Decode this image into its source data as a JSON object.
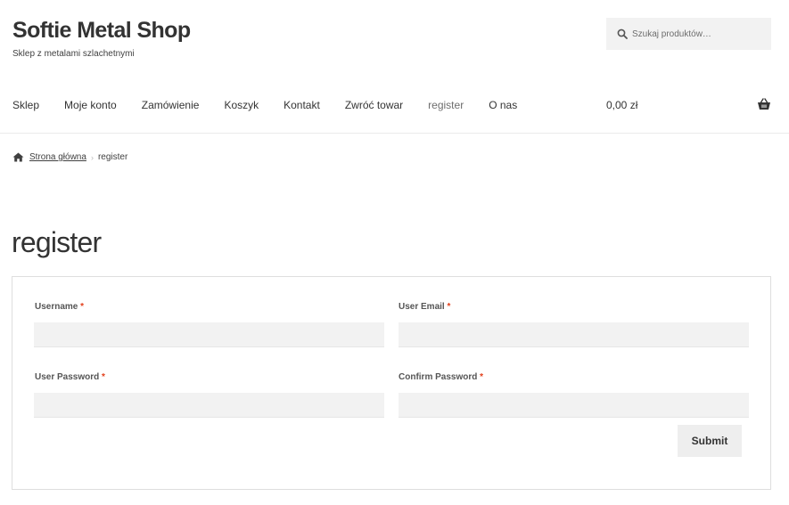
{
  "site": {
    "title": "Softie Metal Shop",
    "tagline": "Sklep z metalami szlachetnymi"
  },
  "search": {
    "placeholder": "Szukaj produktów…",
    "icon": "search-icon"
  },
  "nav": {
    "items": [
      {
        "label": "Sklep"
      },
      {
        "label": "Moje konto"
      },
      {
        "label": "Zamówienie"
      },
      {
        "label": "Koszyk"
      },
      {
        "label": "Kontakt"
      },
      {
        "label": "Zwróć towar"
      },
      {
        "label": "register",
        "current": true
      },
      {
        "label": "O nas"
      }
    ]
  },
  "cart": {
    "total": "0,00 zł",
    "icon": "basket-icon"
  },
  "breadcrumb": {
    "home_icon": "home-icon",
    "home_label": "Strona główna",
    "separator": "›",
    "current": "register"
  },
  "page": {
    "title": "register"
  },
  "form": {
    "required_marker": "*",
    "username_label": "Username",
    "email_label": "User Email",
    "password_label": "User Password",
    "confirm_label": "Confirm Password",
    "username_value": "",
    "email_value": "",
    "password_value": "",
    "confirm_value": "",
    "submit_label": "Submit"
  },
  "colors": {
    "text": "#404040",
    "heading": "#333333",
    "required": "#e2401c",
    "field_bg": "#f2f2f2",
    "button_bg": "#eeeeee",
    "border": "#dedede"
  }
}
